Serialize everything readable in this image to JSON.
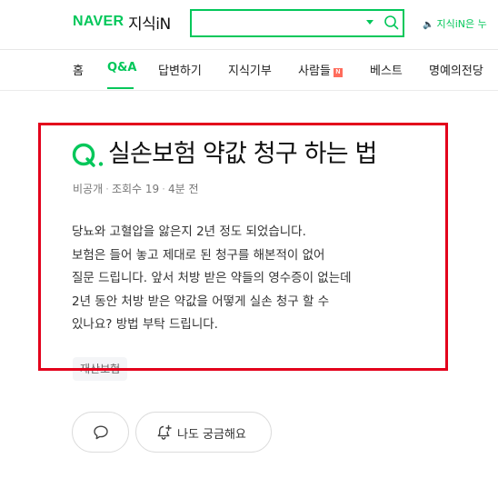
{
  "header": {
    "logo_naver": "NAVER",
    "logo_kin": "지식iN",
    "search": {
      "value": "",
      "placeholder": ""
    },
    "notice": "지식iN은 누"
  },
  "nav": {
    "items": [
      {
        "label": "홈",
        "active": false
      },
      {
        "label": "Q&A",
        "active": true
      },
      {
        "label": "답변하기",
        "active": false
      },
      {
        "label": "지식기부",
        "active": false
      },
      {
        "label": "사람들",
        "active": false,
        "badge": "N"
      },
      {
        "label": "베스트",
        "active": false
      },
      {
        "label": "명예의전당",
        "active": false
      }
    ]
  },
  "question": {
    "mark": "Q.",
    "title": "실손보험 약값 청구 하는 법",
    "meta": {
      "author": "비공개",
      "views": "조회수 19",
      "time": "4분 전"
    },
    "body_lines": [
      "당뇨와 고혈압을 앓은지 2년 정도 되었습니다.",
      "보험은 들어 놓고 제대로 된 청구를 해본적이 없어",
      "질문 드립니다. 앞서 처방 받은 약들의 영수증이 없는데",
      "2년 동안 처방 받은 약값을 어떻게 실손 청구 할 수",
      "있나요? 방법 부탁 드립니다."
    ],
    "tag": "재산보험"
  },
  "actions": {
    "comment_icon": "speech-bubble-icon",
    "curious_icon": "bell-plus-icon",
    "curious_label": "나도 궁금해요"
  },
  "colors": {
    "brand": "#03c75a",
    "highlight_box": "#e3001b",
    "badge": "#ff6c5c"
  }
}
